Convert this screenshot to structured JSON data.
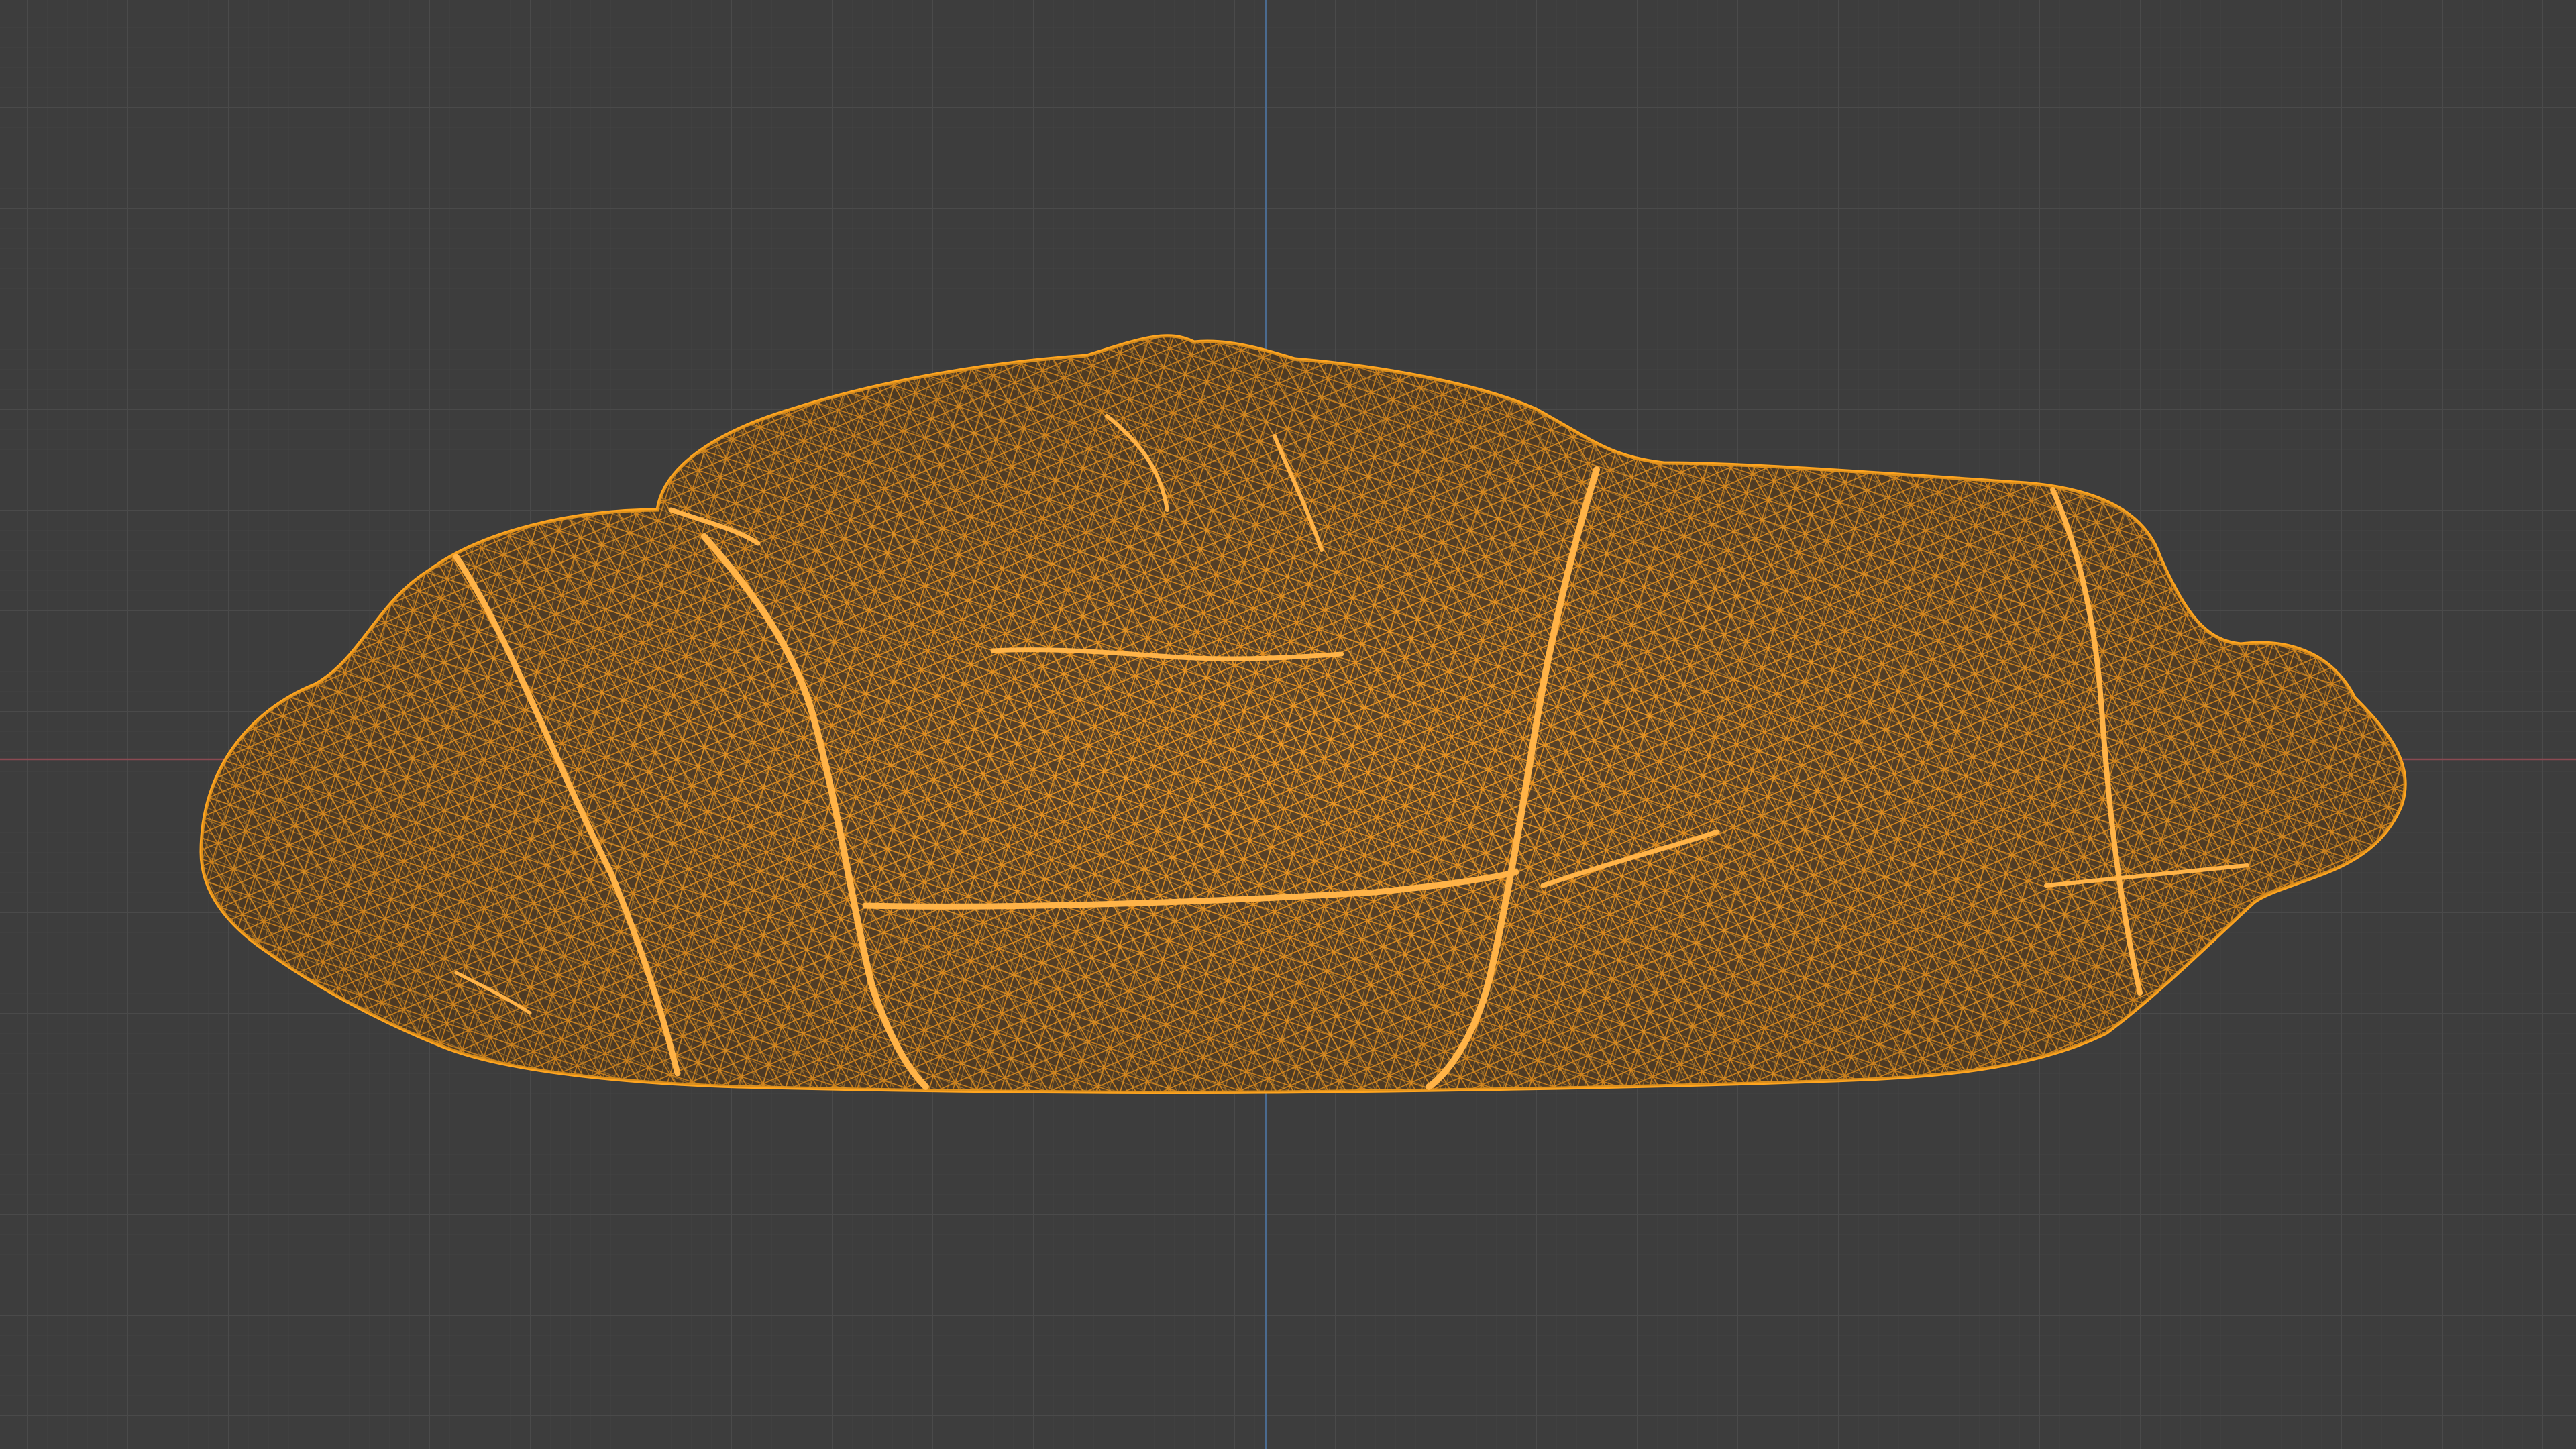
{
  "viewport": {
    "background_color": "#3d3d3d",
    "grid_minor_color": "#434343",
    "grid_major_color": "#484848",
    "x_axis_color": "#8b4a52",
    "y_axis_color": "#4a6a8f",
    "wire_color": "#ff9f1f",
    "wire_fill_color": "#7a4f16",
    "wire_highlight_color": "#ffb347",
    "object_icon": "wireframe-mesh-icon"
  }
}
